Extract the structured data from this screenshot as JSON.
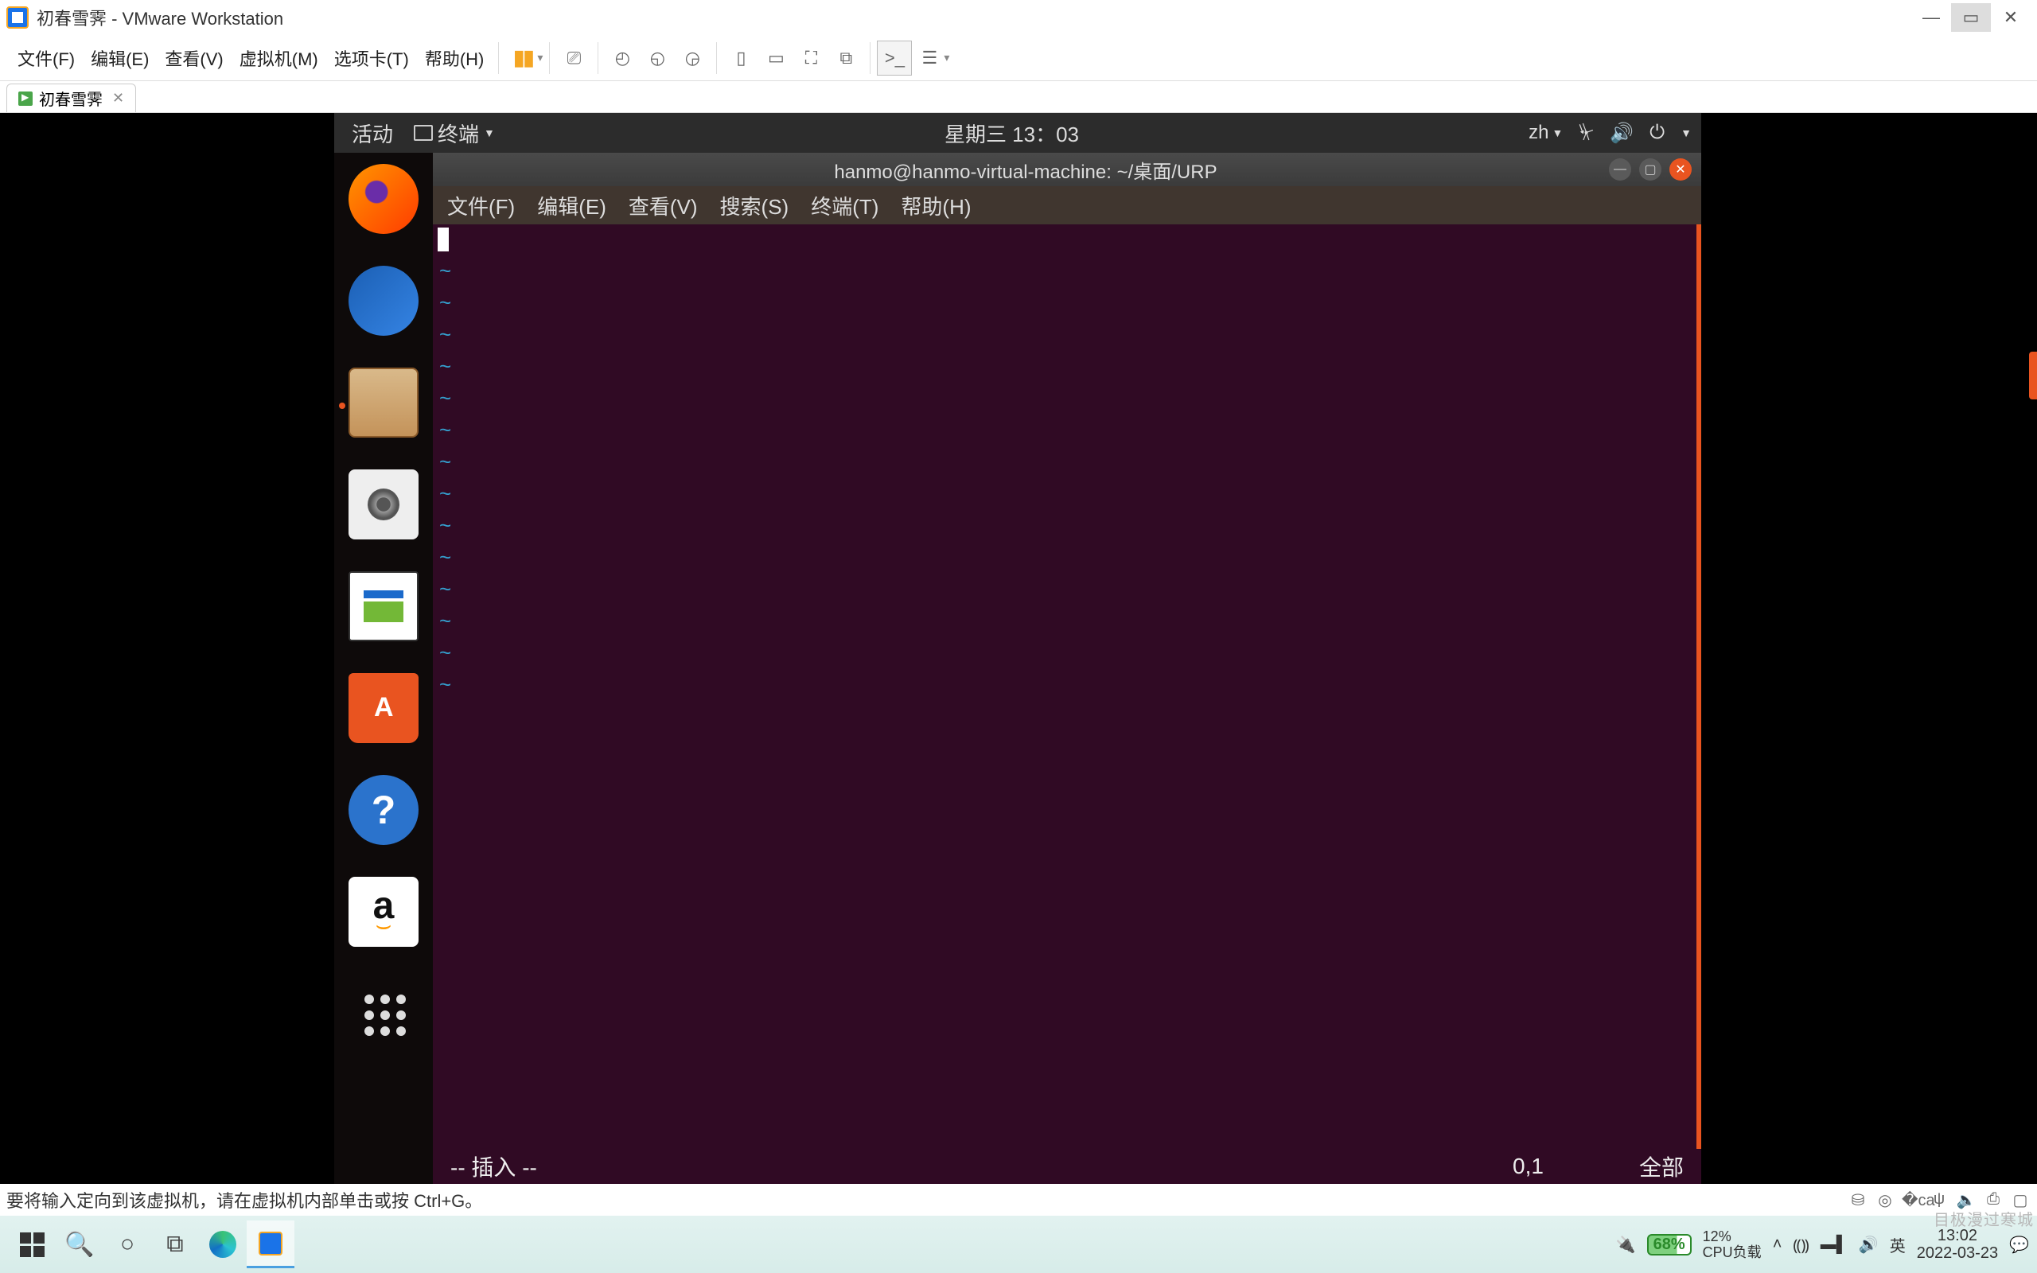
{
  "vmware": {
    "title": "初春雪霁 - VMware Workstation",
    "menus": [
      "文件(F)",
      "编辑(E)",
      "查看(V)",
      "虚拟机(M)",
      "选项卡(T)",
      "帮助(H)"
    ],
    "tab_label": "初春雪霁",
    "footer_hint": "要将输入定向到该虚拟机，请在虚拟机内部单击或按 Ctrl+G。"
  },
  "ubuntu": {
    "activities": "活动",
    "terminal_indicator": "终端",
    "datetime": "星期三 13：03",
    "lang": "zh"
  },
  "terminal": {
    "title": "hanmo@hanmo-virtual-machine: ~/桌面/URP",
    "menus": [
      "文件(F)",
      "编辑(E)",
      "查看(V)",
      "搜索(S)",
      "终端(T)",
      "帮助(H)"
    ],
    "vim_mode": "-- 插入 --",
    "vim_pos": "0,1",
    "vim_scope": "全部",
    "tilde_count": 14
  },
  "windows": {
    "battery_pct": "68%",
    "cpu_pct": "12%",
    "cpu_label": "CPU负载",
    "ime": "英",
    "time": "13:02",
    "date": "2022-03-23",
    "watermark": "目极漫过寒城"
  }
}
